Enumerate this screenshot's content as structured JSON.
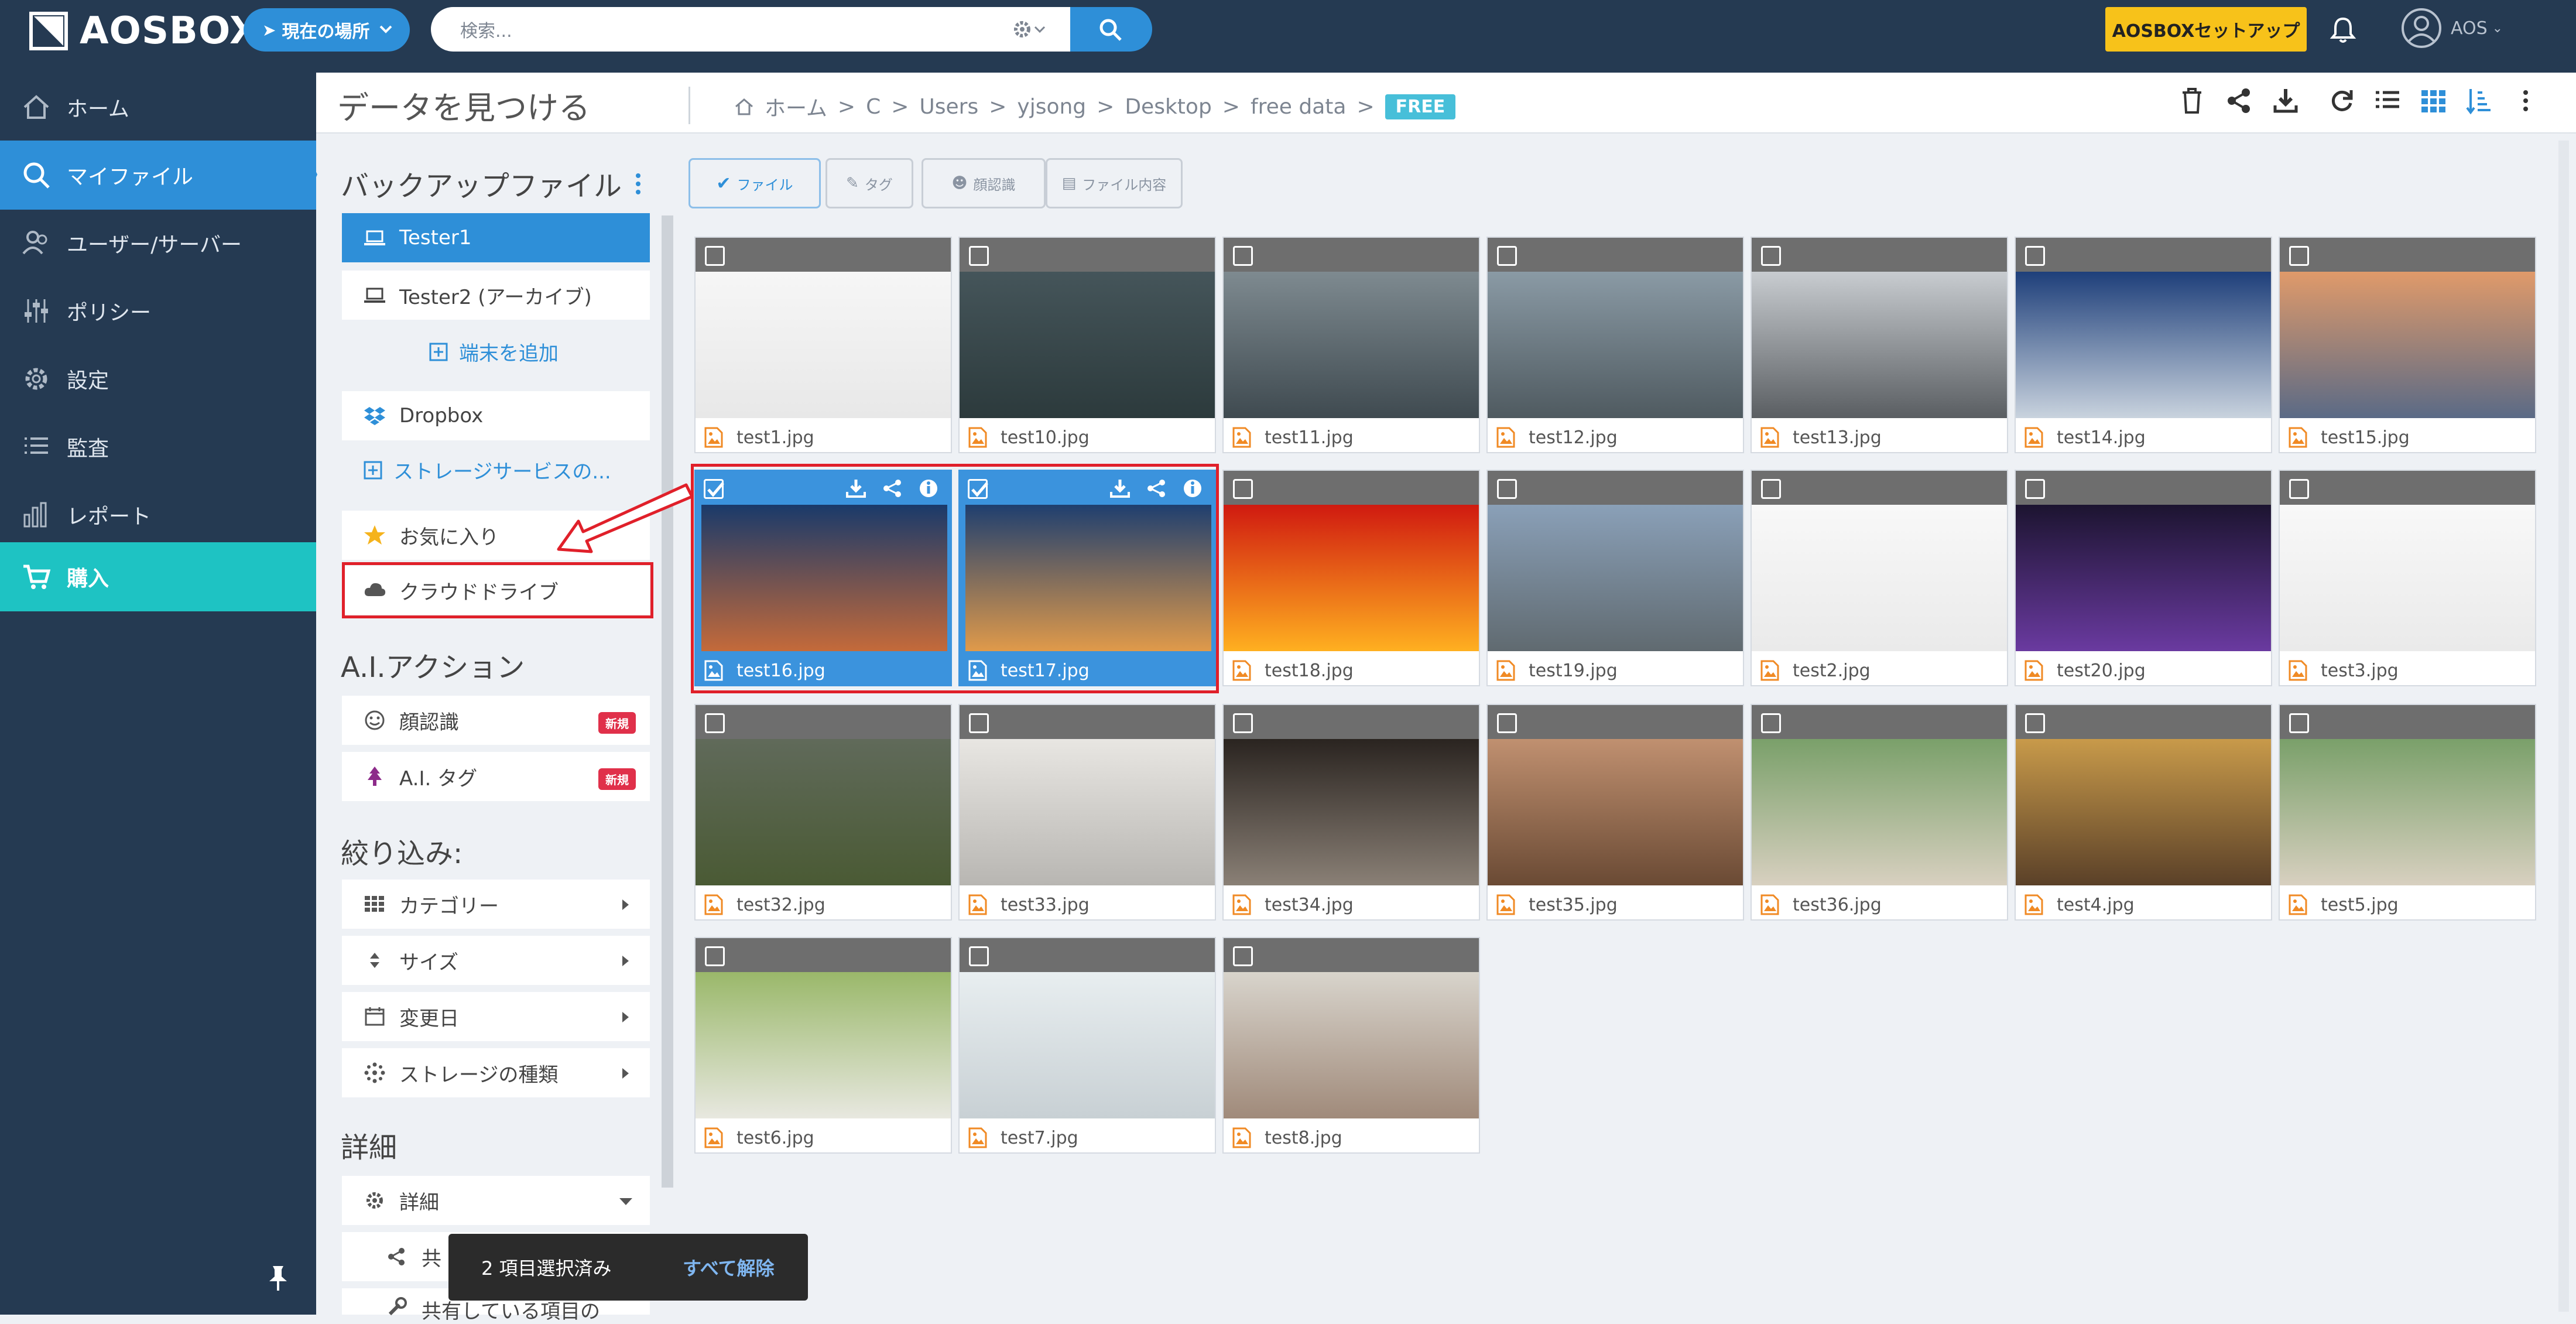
{
  "app": {
    "name": "AOSBOX"
  },
  "topbar": {
    "location_label": "現在の場所",
    "search_placeholder": "検索...",
    "setup_label": "AOSBOXセットアップ",
    "user_label": "AOS"
  },
  "sidebar": {
    "items": [
      {
        "label": "ホーム",
        "icon": "home-icon"
      },
      {
        "label": "マイファイル",
        "icon": "search-icon"
      },
      {
        "label": "ユーザー/サーバー",
        "icon": "users-icon"
      },
      {
        "label": "ポリシー",
        "icon": "sliders-icon"
      },
      {
        "label": "設定",
        "icon": "gear-icon"
      },
      {
        "label": "監査",
        "icon": "list-icon"
      },
      {
        "label": "レポート",
        "icon": "chart-icon"
      },
      {
        "label": "購入",
        "icon": "cart-icon"
      }
    ]
  },
  "header": {
    "title": "データを見つける",
    "breadcrumb": [
      "ホーム",
      "C",
      "Users",
      "yjsong",
      "Desktop",
      "free data"
    ],
    "badge": "FREE"
  },
  "panel": {
    "backup_title": "バックアップファイル",
    "devices": [
      "Tester1",
      "Tester2 (アーカイブ)"
    ],
    "add_device": "端末を追加",
    "dropbox": "Dropbox",
    "storage_link": "ストレージサービスの...",
    "favorites": "お気に入り",
    "cloud_drive": "クラウドドライブ",
    "ai_title": "A.I.アクション",
    "ai_items": [
      {
        "label": "顔認識",
        "badge": "新規"
      },
      {
        "label": "A.I. タグ",
        "badge": "新規"
      }
    ],
    "filter_title": "絞り込み:",
    "filters": [
      "カテゴリー",
      "サイズ",
      "変更日",
      "ストレージの種類"
    ],
    "detail_title": "詳細",
    "detail_item": "詳細",
    "detail_sub1": "共",
    "detail_sub2": "共有している項目の"
  },
  "chips": [
    "ファイル",
    "タグ",
    "顔認識",
    "ファイル内容"
  ],
  "files": [
    "test1.jpg",
    "test10.jpg",
    "test11.jpg",
    "test12.jpg",
    "test13.jpg",
    "test14.jpg",
    "test15.jpg",
    "test16.jpg",
    "test17.jpg",
    "test18.jpg",
    "test19.jpg",
    "test2.jpg",
    "test20.jpg",
    "test3.jpg",
    "test32.jpg",
    "test33.jpg",
    "test34.jpg",
    "test35.jpg",
    "test36.jpg",
    "test4.jpg",
    "test5.jpg",
    "test6.jpg",
    "test7.jpg",
    "test8.jpg"
  ],
  "toast": {
    "selected": "2 項目選択済み",
    "clear": "すべて解除"
  },
  "colors": {
    "nav_bg": "#253a52",
    "accent": "#2e8fd8",
    "buy": "#1ec3c3",
    "setup": "#f7c21a",
    "highlight": "#e0202a"
  }
}
